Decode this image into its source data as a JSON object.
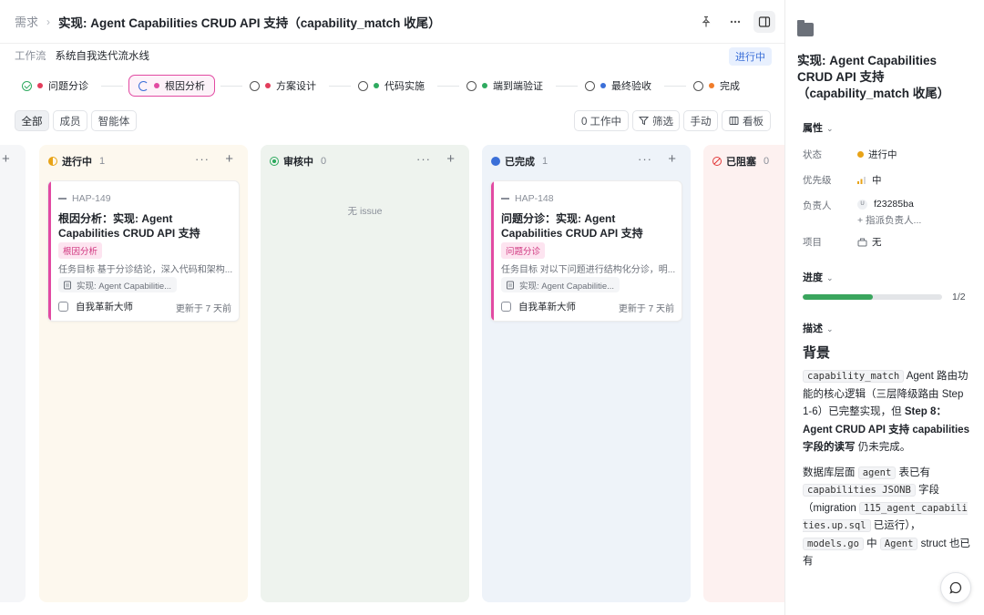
{
  "header": {
    "breadcrumb": "需求",
    "title": "实现: Agent Capabilities CRUD API 支持（capability_match 收尾）"
  },
  "workflow": {
    "label": "工作流",
    "value": "系统自我迭代流水线",
    "status": "进行中"
  },
  "stages": [
    {
      "label": "问题分诊",
      "color": "#e23d5b"
    },
    {
      "label": "根因分析",
      "color": "#e24aa2"
    },
    {
      "label": "方案设计",
      "color": "#e23d5b"
    },
    {
      "label": "代码实施",
      "color": "#2eaa5f"
    },
    {
      "label": "端到端验证",
      "color": "#2eaa5f"
    },
    {
      "label": "最终验收",
      "color": "#3b6fd8"
    },
    {
      "label": "完成",
      "color": "#f07c2a"
    }
  ],
  "toolbar": {
    "filters": [
      "全部",
      "成员",
      "智能体"
    ],
    "working": "0 工作中",
    "filter": "筛选",
    "manual": "手动",
    "board": "看板"
  },
  "columns": [
    {
      "label": "进行中",
      "count": "1",
      "color": "#e8a317",
      "card": {
        "id": "HAP-149",
        "title": "根因分析：实现: Agent Capabilities CRUD API 支持（capability_matc...",
        "tag": "根因分析",
        "desc": "任务目标 基于分诊结论，深入代码和架构...",
        "link": "实现: Agent Capabilitie...",
        "user": "自我革新大师",
        "time": "更新于 7 天前"
      }
    },
    {
      "label": "审核中",
      "count": "0",
      "color": "#2eaa5f",
      "empty": "无 issue"
    },
    {
      "label": "已完成",
      "count": "1",
      "color": "#3b6fd8",
      "card": {
        "id": "HAP-148",
        "title": "问题分诊：实现: Agent Capabilities CRUD API 支持（capability_matc...",
        "tag": "问题分诊",
        "desc": "任务目标 对以下问题进行结构化分诊，明...",
        "link": "实现: Agent Capabilitie...",
        "user": "自我革新大师",
        "time": "更新于 7 天前"
      }
    },
    {
      "label": "已阻塞",
      "count": "0",
      "color": "#e23d3d"
    }
  ],
  "panel": {
    "title": "实现: Agent Capabilities CRUD API 支持（capability_match 收尾）",
    "props_label": "属性",
    "status_key": "状态",
    "status_val": "进行中",
    "priority_key": "优先级",
    "priority_val": "中",
    "assignee_key": "负责人",
    "assignee_avatar": "U",
    "assignee_val": "f23285ba",
    "assign_more": "+ 指派负责人...",
    "project_key": "项目",
    "project_val": "无",
    "progress_label": "进度",
    "progress_value": 0.5,
    "progress_text": "1/2",
    "desc_label": "描述",
    "heading": "背景",
    "p1_code": "capability_match",
    "p1_text": " Agent 路由功能的核心逻辑（三层降级路由 Step 1-6）已完整实现，但 ",
    "p1_bold": "Step 8：Agent CRUD API 支持 capabilities 字段的读写",
    "p1_end": " 仍未完成。",
    "p2_a": "数据库层面 ",
    "p2_code1": "agent",
    "p2_b": " 表已有 ",
    "p2_code2": "capabilities JSONB",
    "p2_c": " 字段（migration ",
    "p2_code3": "115_agent_capabilities.up.sql",
    "p2_d": " 已运行），",
    "p2_code4": "models.go",
    "p2_e": " 中 ",
    "p2_code5": "Agent",
    "p2_f": " struct 也已有"
  }
}
